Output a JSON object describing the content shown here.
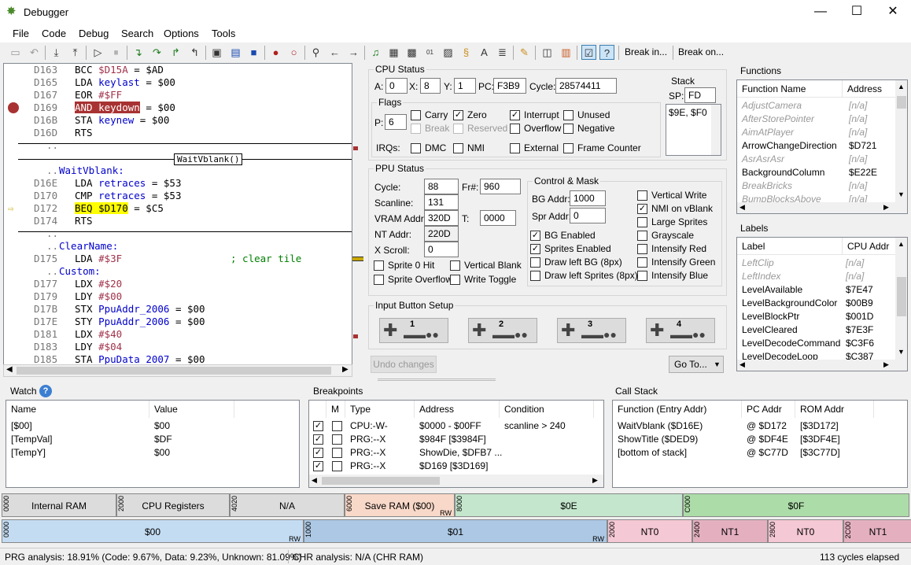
{
  "window": {
    "title": "Debugger"
  },
  "menu": [
    "File",
    "Code",
    "Debug",
    "Search",
    "Options",
    "Tools"
  ],
  "toolbar": {
    "break_in": "Break in...",
    "break_on": "Break on..."
  },
  "code_lines": [
    {
      "addr": "D163",
      "pre": "BCC ",
      "op": "$D15A",
      "post": " = $AD"
    },
    {
      "addr": "D165",
      "pre": "LDA ",
      "lbl": "keylast",
      "post": " = $00"
    },
    {
      "addr": "D167",
      "pre": "EOR ",
      "op": "#$FF"
    },
    {
      "addr": "D169",
      "pre": "AND keydown",
      "post": " = $00"
    },
    {
      "addr": "D16B",
      "pre": "STA ",
      "lbl": "keynew",
      "post": " = $00"
    },
    {
      "addr": "D16D",
      "pre": "RTS"
    },
    {
      "addr": "D16E",
      "pre": "LDA ",
      "lbl": "retraces",
      "post": " = $53"
    },
    {
      "addr": "D170",
      "pre": "CMP ",
      "lbl": "retraces",
      "post": " = $53"
    },
    {
      "addr": "D172",
      "pre": "BEQ $D170",
      "post": " = $C5"
    },
    {
      "addr": "D174",
      "pre": "RTS"
    },
    {
      "addr": "D175",
      "pre": "LDA ",
      "op": "#$3F",
      "cmt": "; clear tile"
    },
    {
      "addr": "D177",
      "pre": "LDX ",
      "op": "#$20"
    },
    {
      "addr": "D179",
      "pre": "LDY ",
      "op": "#$00"
    },
    {
      "addr": "D17B",
      "pre": "STX ",
      "lbl": "PpuAddr_2006",
      "post": " = $00"
    },
    {
      "addr": "D17E",
      "pre": "STY ",
      "lbl": "PpuAddr_2006",
      "post": " = $00"
    },
    {
      "addr": "D181",
      "pre": "LDX ",
      "op": "#$40"
    },
    {
      "addr": "D183",
      "pre": "LDY ",
      "op": "#$04"
    },
    {
      "addr": "D185",
      "pre": "STA ",
      "lbl": "PpuData_2007",
      "post": " = $00"
    }
  ],
  "code_labels": {
    "waitvblank_box": "WaitVblank()",
    "waitvblank": "WaitVblank:",
    "clearname": "ClearName:",
    "custom": "Custom:",
    "dots": ".."
  },
  "cpu": {
    "title": "CPU Status",
    "a_label": "A:",
    "a": "0",
    "x_label": "X:",
    "x": "8",
    "y_label": "Y:",
    "y": "1",
    "pc_label": "PC:",
    "pc": "F3B9",
    "cycle_label": "Cycle:",
    "cycle": "28574411",
    "flags_title": "Flags",
    "p_label": "P:",
    "p": "6",
    "stack_title": "Stack",
    "sp_label": "SP:",
    "sp": "FD",
    "stack": "$9E, $F0",
    "flags": {
      "carry": "Carry",
      "zero": "Zero",
      "interrupt": "Interrupt",
      "unused": "Unused",
      "break": "Break",
      "reserved": "Reserved",
      "overflow": "Overflow",
      "negative": "Negative"
    },
    "irqs_label": "IRQs:",
    "dmc": "DMC",
    "nmi": "NMI",
    "external": "External",
    "frame_counter": "Frame Counter"
  },
  "ppu": {
    "title": "PPU Status",
    "cycle_label": "Cycle:",
    "cycle": "88",
    "frame_label": "Fr#:",
    "frame": "960",
    "scanline_label": "Scanline:",
    "scanline": "131",
    "vram_label": "VRAM Addr:",
    "vram": "320D",
    "t_label": "T:",
    "t": "0000",
    "nt_label": "NT Addr:",
    "nt": "220D",
    "xscroll_label": "X Scroll:",
    "xscroll": "0",
    "sprite0": "Sprite 0 Hit",
    "vblank": "Vertical Blank",
    "overflow": "Sprite Overflow",
    "write_toggle": "Write Toggle",
    "control_title": "Control & Mask",
    "bg_addr_label": "BG Addr:",
    "bg_addr": "1000",
    "spr_addr_label": "Spr Addr:",
    "spr_addr": "0",
    "bg_enabled": "BG Enabled",
    "sprites_enabled": "Sprites Enabled",
    "draw_left_bg": "Draw left BG (8px)",
    "draw_left_spr": "Draw left Sprites (8px)",
    "vertical_write": "Vertical Write",
    "nmi_vblank": "NMI on vBlank",
    "large_sprites": "Large Sprites",
    "grayscale": "Grayscale",
    "intensify_red": "Intensify Red",
    "intensify_green": "Intensify Green",
    "intensify_blue": "Intensify Blue"
  },
  "input": {
    "title": "Input Button Setup",
    "pads": [
      "1",
      "2",
      "3",
      "4"
    ],
    "undo": "Undo changes",
    "goto": "Go To..."
  },
  "functions": {
    "title": "Functions",
    "col_name": "Function Name",
    "col_addr": "Address",
    "rows": [
      {
        "name": "AdjustCamera",
        "addr": "[n/a]",
        "grey": true
      },
      {
        "name": "AfterStorePointer",
        "addr": "[n/a]",
        "grey": true
      },
      {
        "name": "AimAtPlayer",
        "addr": "[n/a]",
        "grey": true
      },
      {
        "name": "ArrowChangeDirection",
        "addr": "$D721",
        "grey": false
      },
      {
        "name": "AsrAsrAsr",
        "addr": "[n/a]",
        "grey": true
      },
      {
        "name": "BackgroundColumn",
        "addr": "$E22E",
        "grey": false
      },
      {
        "name": "BreakBricks",
        "addr": "[n/a]",
        "grey": true
      },
      {
        "name": "BumpBlocksAbove",
        "addr": "[n/a]",
        "grey": true
      }
    ]
  },
  "labels": {
    "title": "Labels",
    "col_name": "Label",
    "col_addr": "CPU Addr",
    "rows": [
      {
        "name": "LeftClip",
        "addr": "[n/a]",
        "grey": true
      },
      {
        "name": "LeftIndex",
        "addr": "[n/a]",
        "grey": true
      },
      {
        "name": "LevelAvailable",
        "addr": "$7E47",
        "grey": false
      },
      {
        "name": "LevelBackgroundColor",
        "addr": "$00B9",
        "grey": false
      },
      {
        "name": "LevelBlockPtr",
        "addr": "$001D",
        "grey": false
      },
      {
        "name": "LevelCleared",
        "addr": "$7E3F",
        "grey": false
      },
      {
        "name": "LevelDecodeCommand",
        "addr": "$C3F6",
        "grey": false
      },
      {
        "name": "LevelDecodeLoop",
        "addr": "$C387",
        "grey": false
      }
    ]
  },
  "watch": {
    "title": "Watch",
    "col_name": "Name",
    "col_value": "Value",
    "rows": [
      {
        "name": "[$00]",
        "value": "$00"
      },
      {
        "name": "[TempVal]",
        "value": "$DF"
      },
      {
        "name": "[TempY]",
        "value": "$00"
      }
    ]
  },
  "breakpoints": {
    "title": "Breakpoints",
    "col_m": "M",
    "col_type": "Type",
    "col_addr": "Address",
    "col_cond": "Condition",
    "rows": [
      {
        "type": "CPU:-W-",
        "addr": "$0000 - $00FF",
        "cond": "scanline > 240"
      },
      {
        "type": "PRG:--X",
        "addr": "$984F [$3984F]",
        "cond": ""
      },
      {
        "type": "PRG:--X",
        "addr": "ShowDie, $DFB7 ...",
        "cond": ""
      },
      {
        "type": "PRG:--X",
        "addr": "$D169 [$3D169]",
        "cond": ""
      }
    ]
  },
  "callstack": {
    "title": "Call Stack",
    "col_fn": "Function (Entry Addr)",
    "col_pc": "PC Addr",
    "col_rom": "ROM Addr",
    "rows": [
      {
        "fn": "WaitVblank ($D16E)",
        "pc": "@ $D172",
        "rom": "[$3D172]"
      },
      {
        "fn": "ShowTitle ($DED9)",
        "pc": "@ $DF4E",
        "rom": "[$3DF4E]"
      },
      {
        "fn": "[bottom of stack]",
        "pc": "@ $C77D",
        "rom": "[$3C77D]"
      }
    ]
  },
  "memmap": {
    "row1": [
      {
        "addr": "0000",
        "label": "Internal RAM",
        "color": "#dcdcdc",
        "rw": ""
      },
      {
        "addr": "2000",
        "label": "CPU Registers",
        "color": "#dcdcdc",
        "rw": ""
      },
      {
        "addr": "4020",
        "label": "N/A",
        "color": "#dcdcdc",
        "rw": ""
      },
      {
        "addr": "6000",
        "label": "Save RAM ($00)",
        "color": "#f8d8c8",
        "rw": "RW"
      },
      {
        "addr": "8000",
        "label": "$0E",
        "color": "#c4e6cc",
        "rw": ""
      },
      {
        "addr": "C000",
        "label": "$0F",
        "color": "#acdca8",
        "rw": ""
      }
    ],
    "row2": [
      {
        "addr": "0000",
        "label": "$00",
        "color": "#c4dcf2",
        "rw": "RW"
      },
      {
        "addr": "1000",
        "label": "$01",
        "color": "#acc8e4",
        "rw": "RW"
      },
      {
        "addr": "2000",
        "label": "NT0",
        "color": "#f4c8d4",
        "rw": ""
      },
      {
        "addr": "2400",
        "label": "NT1",
        "color": "#e4b0c0",
        "rw": ""
      },
      {
        "addr": "2800",
        "label": "NT0",
        "color": "#f4c8d4",
        "rw": ""
      },
      {
        "addr": "2C00",
        "label": "NT1",
        "color": "#e4b0c0",
        "rw": ""
      }
    ]
  },
  "status": {
    "prg": "PRG analysis:  18.91% (Code: 9.67%, Data: 9.23%, Unknown: 81.09%)",
    "chr": "CHR analysis:  N/A (CHR RAM)",
    "cycles": "113 cycles elapsed"
  }
}
